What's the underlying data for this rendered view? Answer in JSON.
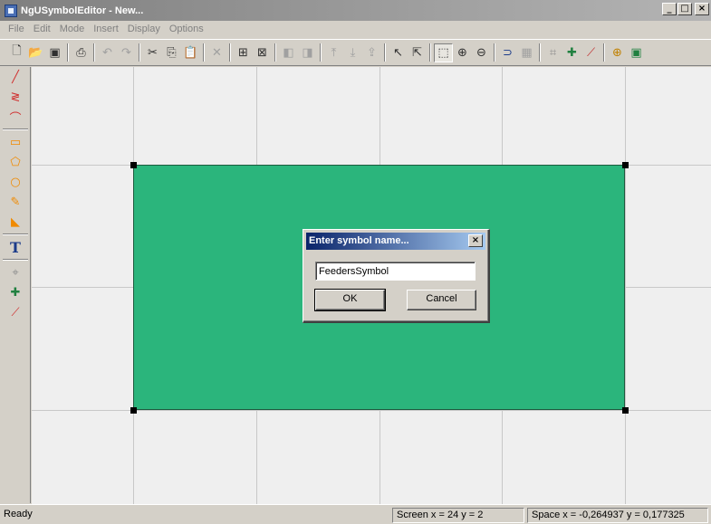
{
  "window": {
    "title": "NgUSymbolEditor - New...",
    "minimize_label": "_",
    "maximize_label": "□",
    "close_label": "×"
  },
  "menu": [
    {
      "label": "File"
    },
    {
      "label": "Edit"
    },
    {
      "label": "Mode"
    },
    {
      "label": "Insert"
    },
    {
      "label": "Display"
    },
    {
      "label": "Options"
    }
  ],
  "toolbar": {
    "icons": [
      "new-file-icon",
      "open-folder-icon",
      "save-icon",
      "print-icon",
      "undo-icon",
      "redo-icon",
      "cut-icon",
      "copy-icon",
      "paste-icon",
      "delete-icon",
      "group-icon",
      "ungroup-icon",
      "bring-front-icon",
      "send-back-icon",
      "align-left-icon",
      "align-center-icon",
      "align-right-icon",
      "select-arrow-icon",
      "multi-select-icon",
      "zoom-window-icon",
      "zoom-in-icon",
      "zoom-out-icon",
      "snap-icon",
      "grid-icon",
      "insert-text-pin-icon",
      "insert-pin-icon",
      "insert-connector-icon",
      "anchor-icon",
      "frame-icon"
    ]
  },
  "left_tools": [
    "line-tool-icon",
    "polyline-tool-icon",
    "arc-tool-icon",
    "rectangle-tool-icon",
    "polygon-tool-icon",
    "circle-tool-icon",
    "pencil-tool-icon",
    "fill-tool-icon",
    "text-tool-icon",
    "text-pin-tool-icon",
    "pin-tool-icon",
    "connector-tool-icon"
  ],
  "left_tools_text_label": "T",
  "colors": {
    "symbol_fill": "#2bb57c",
    "canvas": "#efefef",
    "dialog_title": "#0a246a"
  },
  "dialog": {
    "title": "Enter symbol name...",
    "close_label": "×",
    "input_value": "FeedersSymbol",
    "ok_label": "OK",
    "cancel_label": "Cancel"
  },
  "status": {
    "ready": "Ready",
    "screen": "Screen  x = 24  y = 2",
    "space": "Space  x = -0,264937  y = 0,177325"
  }
}
